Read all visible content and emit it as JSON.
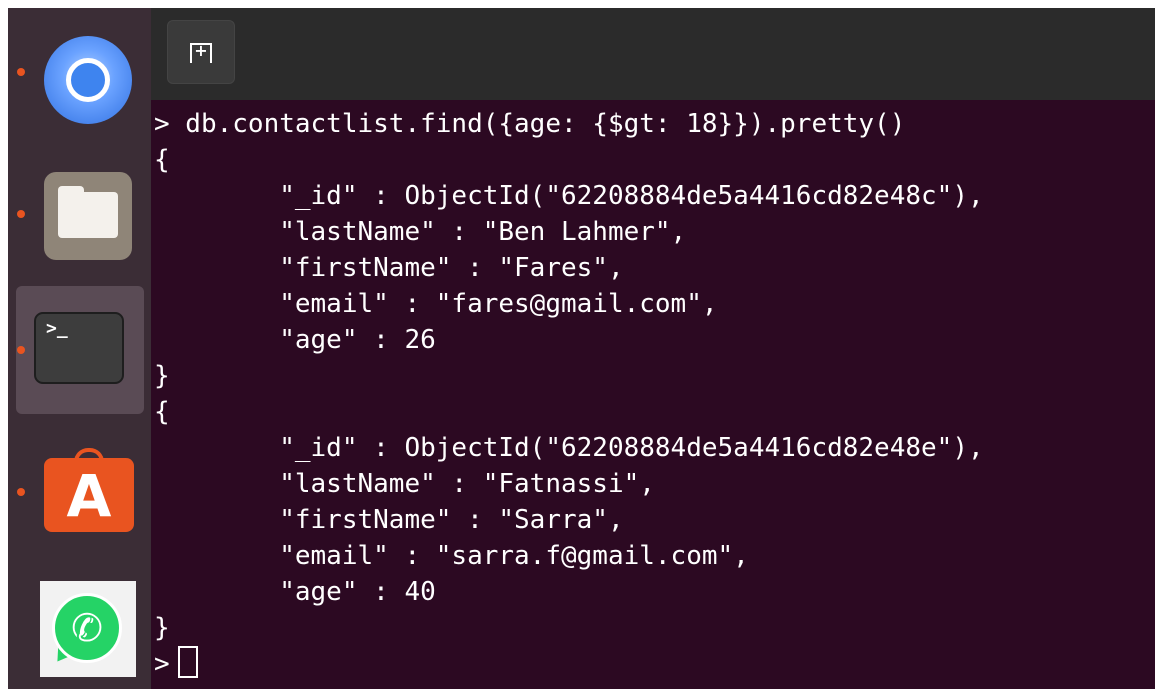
{
  "dock": {
    "items": [
      {
        "name": "chrome",
        "running": true,
        "active": false
      },
      {
        "name": "files",
        "running": true,
        "active": false
      },
      {
        "name": "terminal",
        "running": true,
        "active": true,
        "glyph": ">_"
      },
      {
        "name": "software",
        "running": true,
        "active": false,
        "glyph": "A"
      },
      {
        "name": "whatsapp",
        "running": false,
        "active": false,
        "glyph": "✆"
      }
    ],
    "running_indicator_color": "#e95420"
  },
  "terminal": {
    "new_tab_icon": "new-tab-icon",
    "new_tab_glyph": "+",
    "background": "#2c0922",
    "lines": [
      "> db.contactlist.find({age: {$gt: 18}}).pretty()",
      "{",
      "        \"_id\" : ObjectId(\"62208884de5a4416cd82e48c\"),",
      "        \"lastName\" : \"Ben Lahmer\",",
      "        \"firstName\" : \"Fares\",",
      "        \"email\" : \"fares@gmail.com\",",
      "        \"age\" : 26",
      "}",
      "{",
      "        \"_id\" : ObjectId(\"62208884de5a4416cd82e48e\"),",
      "        \"lastName\" : \"Fatnassi\",",
      "        \"firstName\" : \"Sarra\",",
      "        \"email\" : \"sarra.f@gmail.com\",",
      "        \"age\" : 40",
      "}"
    ],
    "prompt": ">"
  }
}
